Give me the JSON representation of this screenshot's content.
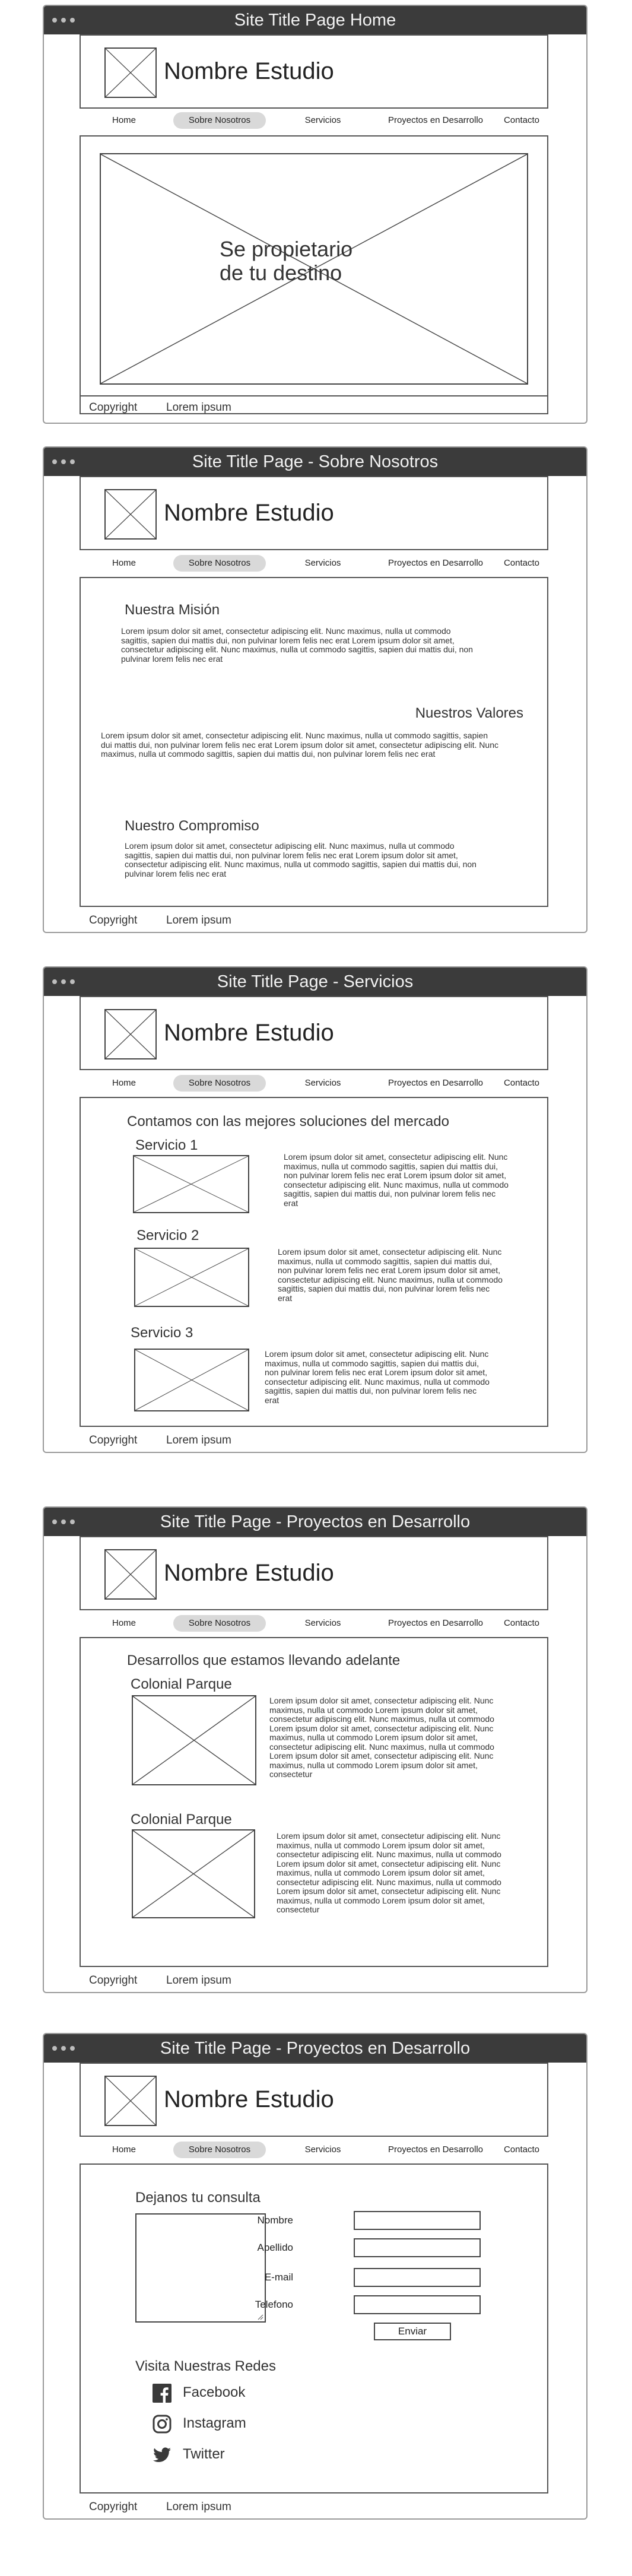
{
  "brand": "Nombre Estudio",
  "nav": [
    "Home",
    "Sobre Nosotros",
    "Servicios",
    "Proyectos en Desarrollo",
    "Contacto"
  ],
  "nav_active_index": 1,
  "footer": {
    "copyright": "Copyright",
    "lorem": "Lorem ipsum"
  },
  "page1": {
    "title": "Site Title Page Home",
    "hero_line1": "Se propietario",
    "hero_line2": "de tu destino"
  },
  "page2": {
    "title": "Site Title Page - Sobre Nosotros",
    "mision_title": "Nuestra Misión",
    "mision_text": "Lorem ipsum dolor sit amet, consectetur adipiscing elit. Nunc maximus, nulla ut commodo sagittis, sapien dui mattis dui, non pulvinar lorem felis nec erat Lorem ipsum dolor sit amet, consectetur adipiscing elit. Nunc maximus, nulla ut commodo sagittis, sapien dui mattis dui, non pulvinar lorem felis nec erat",
    "valores_title": "Nuestros Valores",
    "valores_text": "Lorem ipsum dolor sit amet, consectetur adipiscing elit. Nunc maximus, nulla ut commodo sagittis, sapien dui mattis dui, non pulvinar lorem felis nec erat Lorem ipsum dolor sit amet, consectetur adipiscing elit. Nunc maximus, nulla ut commodo sagittis, sapien dui mattis dui, non pulvinar lorem felis nec erat",
    "compromiso_title": "Nuestro Compromiso",
    "compromiso_text": "Lorem ipsum dolor sit amet, consectetur adipiscing elit. Nunc maximus, nulla ut commodo sagittis, sapien dui mattis dui, non pulvinar lorem felis nec erat Lorem ipsum dolor sit amet, consectetur adipiscing elit. Nunc maximus, nulla ut commodo sagittis, sapien dui mattis dui, non pulvinar lorem felis nec erat"
  },
  "page3": {
    "title": "Site Title Page - Servicios",
    "heading": "Contamos con las mejores soluciones del mercado",
    "services": [
      {
        "name": "Servicio 1",
        "text": "Lorem ipsum dolor sit amet, consectetur adipiscing elit. Nunc maximus, nulla ut commodo sagittis, sapien dui mattis dui, non pulvinar lorem felis nec erat Lorem ipsum dolor sit amet, consectetur adipiscing elit. Nunc maximus, nulla ut commodo sagittis, sapien dui mattis dui, non pulvinar lorem felis nec erat"
      },
      {
        "name": "Servicio 2",
        "text": "Lorem ipsum dolor sit amet, consectetur adipiscing elit. Nunc maximus, nulla ut commodo sagittis, sapien dui mattis dui, non pulvinar lorem felis nec erat Lorem ipsum dolor sit amet, consectetur adipiscing elit. Nunc maximus, nulla ut commodo sagittis, sapien dui mattis dui, non pulvinar lorem felis nec erat"
      },
      {
        "name": "Servicio 3",
        "text": "Lorem ipsum dolor sit amet, consectetur adipiscing elit. Nunc maximus, nulla ut commodo sagittis, sapien dui mattis dui, non pulvinar lorem felis nec erat Lorem ipsum dolor sit amet, consectetur adipiscing elit. Nunc maximus, nulla ut commodo sagittis, sapien dui mattis dui, non pulvinar lorem felis nec erat"
      }
    ]
  },
  "page4": {
    "title": "Site Title Page - Proyectos en Desarrollo",
    "heading": "Desarrollos que estamos llevando adelante",
    "projects": [
      {
        "name": "Colonial Parque",
        "text": "Lorem ipsum dolor sit amet, consectetur adipiscing elit. Nunc maximus, nulla ut commodo Lorem ipsum dolor sit amet, consectetur adipiscing elit. Nunc maximus, nulla ut commodo Lorem ipsum dolor sit amet, consectetur adipiscing elit. Nunc maximus, nulla ut commodo Lorem ipsum dolor sit amet, consectetur adipiscing elit. Nunc maximus, nulla ut commodo Lorem ipsum dolor sit amet, consectetur adipiscing elit. Nunc maximus, nulla ut commodo Lorem ipsum dolor sit amet, consectetur"
      },
      {
        "name": "Colonial Parque",
        "text": "Lorem ipsum dolor sit amet, consectetur adipiscing elit. Nunc maximus, nulla ut commodo Lorem ipsum dolor sit amet, consectetur adipiscing elit. Nunc maximus, nulla ut commodo Lorem ipsum dolor sit amet, consectetur adipiscing elit. Nunc maximus, nulla ut commodo Lorem ipsum dolor sit amet, consectetur adipiscing elit. Nunc maximus, nulla ut commodo Lorem ipsum dolor sit amet, consectetur adipiscing elit. Nunc maximus, nulla ut commodo Lorem ipsum dolor sit amet, consectetur"
      }
    ]
  },
  "page5": {
    "title": "Site Title Page - Proyectos en Desarrollo",
    "form_title": "Dejanos tu consulta",
    "fields": [
      "Nombre",
      "Apellido",
      "E-mail",
      "Telefono"
    ],
    "submit": "Enviar",
    "social_title": "Visita Nuestras Redes",
    "socials": [
      {
        "label": "Facebook",
        "icon": "facebook-icon"
      },
      {
        "label": "Instagram",
        "icon": "instagram-icon"
      },
      {
        "label": "Twitter",
        "icon": "twitter-icon"
      }
    ]
  }
}
